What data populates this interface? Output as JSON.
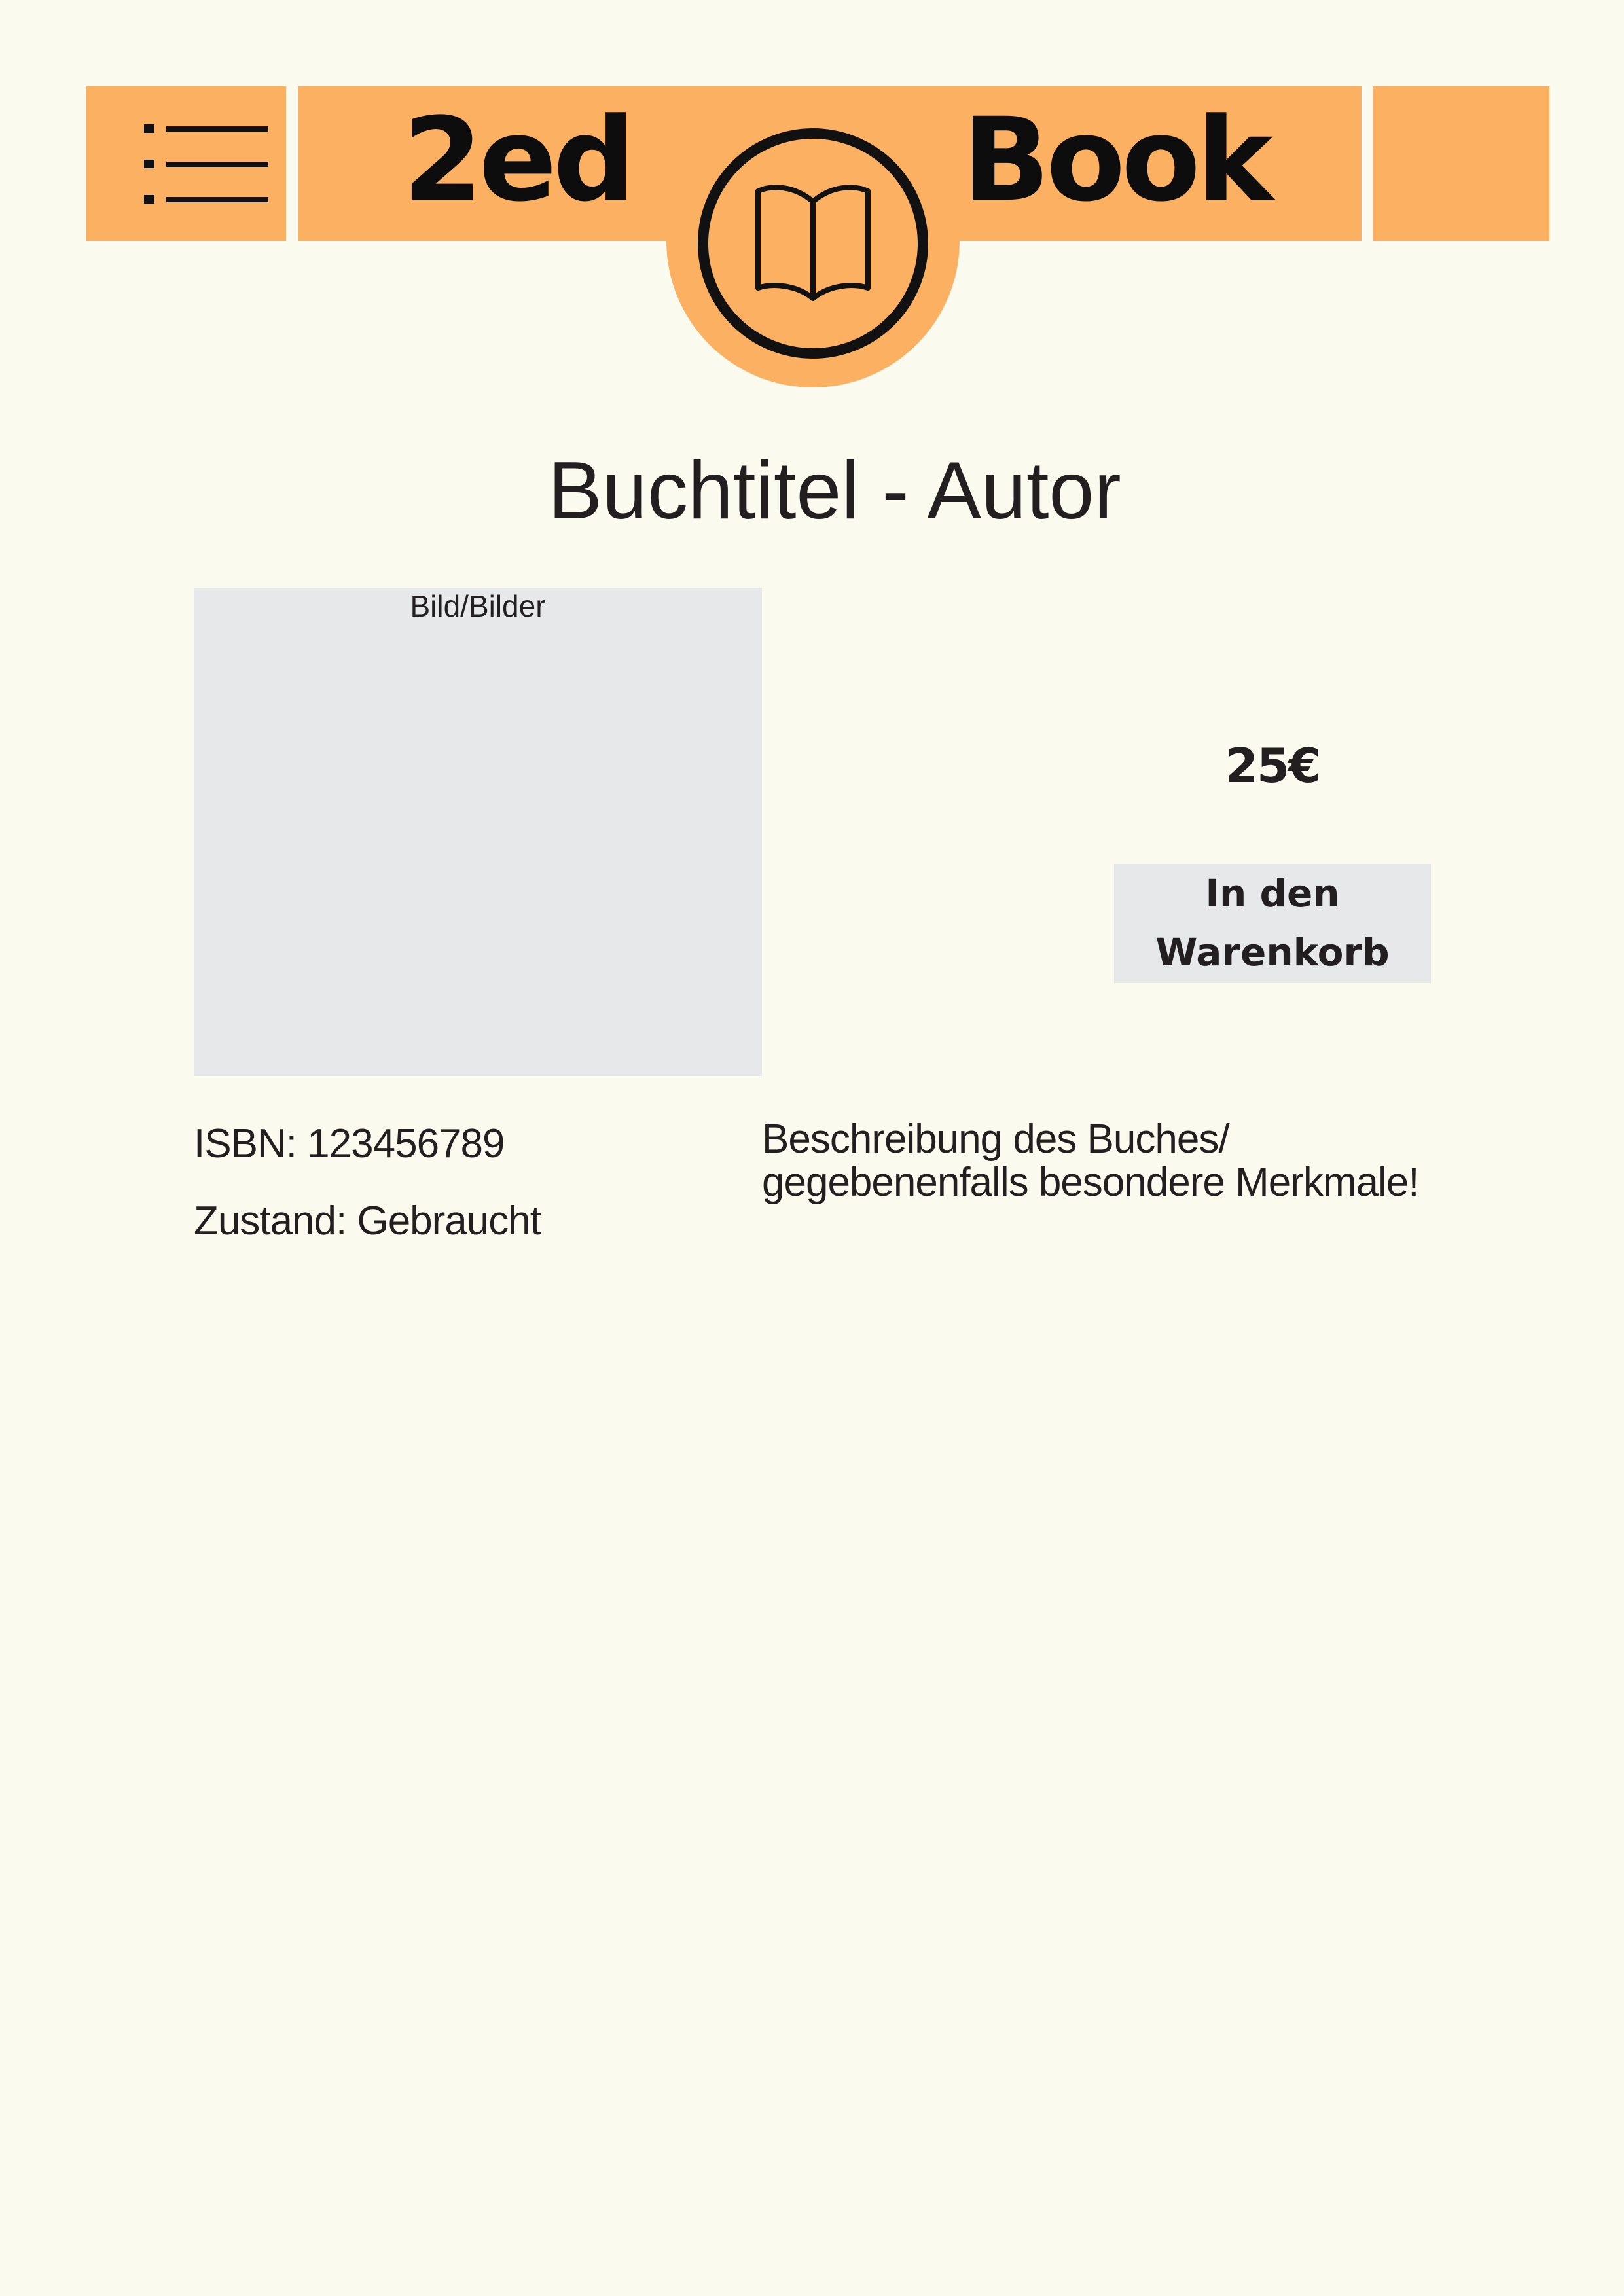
{
  "header": {
    "brand_left": "2ed",
    "brand_right": "Book",
    "menu_icon": "menu-list-icon",
    "logo_icon": "open-book-icon",
    "accent_color": "#fbb062"
  },
  "product": {
    "title": "Buchtitel - Autor",
    "image_caption": "Bild/Bilder",
    "price": "25€",
    "cart_button_label": "In den Warenkorb",
    "isbn": "ISBN: 123456789",
    "condition": "Zustand: Gebraucht",
    "description_lines": [
      "Beschreibung des Buches/",
      "gegebenenfalls besondere Merkmale!"
    ]
  },
  "colors": {
    "background": "#fbfaef",
    "placeholder": "#e7e8ea",
    "text": "#231f20"
  }
}
